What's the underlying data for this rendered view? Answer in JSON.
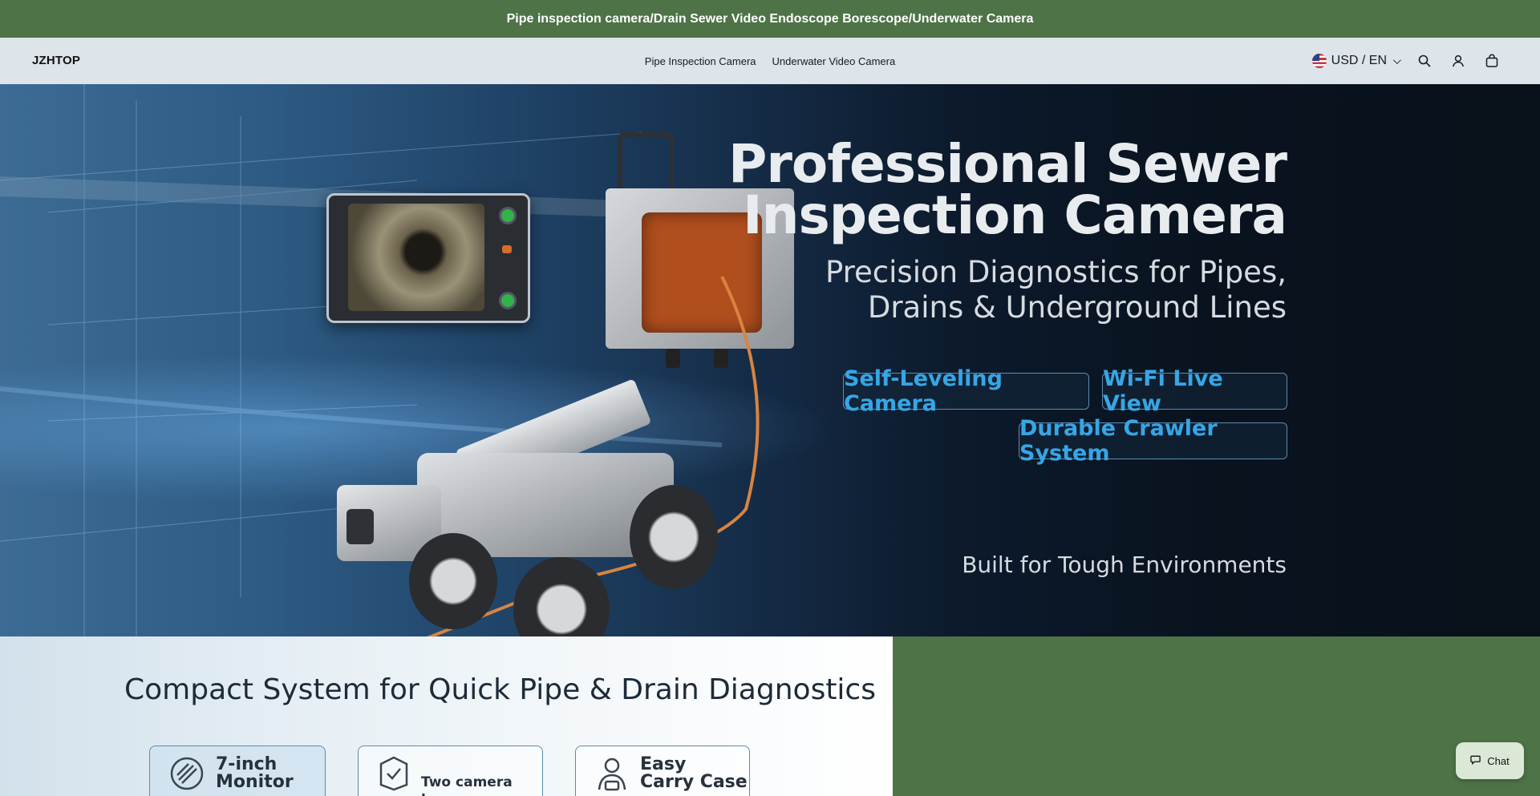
{
  "announcement": {
    "text": "Pipe inspection camera/Drain Sewer Video Endoscope Borescope/Underwater Camera"
  },
  "header": {
    "logo": "JZHTOP",
    "nav": [
      {
        "label": "Pipe Inspection Camera"
      },
      {
        "label": "Underwater Video Camera"
      }
    ],
    "locale": "USD / EN",
    "icons": [
      "us-flag-icon",
      "chevron-down-icon",
      "search-icon",
      "account-icon",
      "cart-icon"
    ]
  },
  "hero": {
    "title_line1": "Professional Sewer",
    "title_line2": "Inspection Camera",
    "subtitle_line1": "Precision Diagnostics for Pipes,",
    "subtitle_line2": "Drains & Underground Lines",
    "features": [
      "Self-Leveling Camera",
      "Wi-Fi Live View",
      "Durable Crawler System"
    ],
    "tagline": "Built for Tough Environments",
    "accent_color": "#36a6e6"
  },
  "feature_panel": {
    "title": "Compact System for Quick Pipe & Drain Diagnostics",
    "cards": [
      {
        "line1": "7-inch",
        "line2": "Monitor",
        "icon": "monitor-icon"
      },
      {
        "line1": "Two camera lens",
        "line2": "",
        "icon": "camera-lens-icon"
      },
      {
        "line1": "Easy",
        "line2": "Carry Case",
        "icon": "carry-case-icon"
      }
    ]
  },
  "chat": {
    "label": "Chat"
  },
  "colors": {
    "brand_green": "#4e7347",
    "header_bg": "#dde4ea"
  }
}
